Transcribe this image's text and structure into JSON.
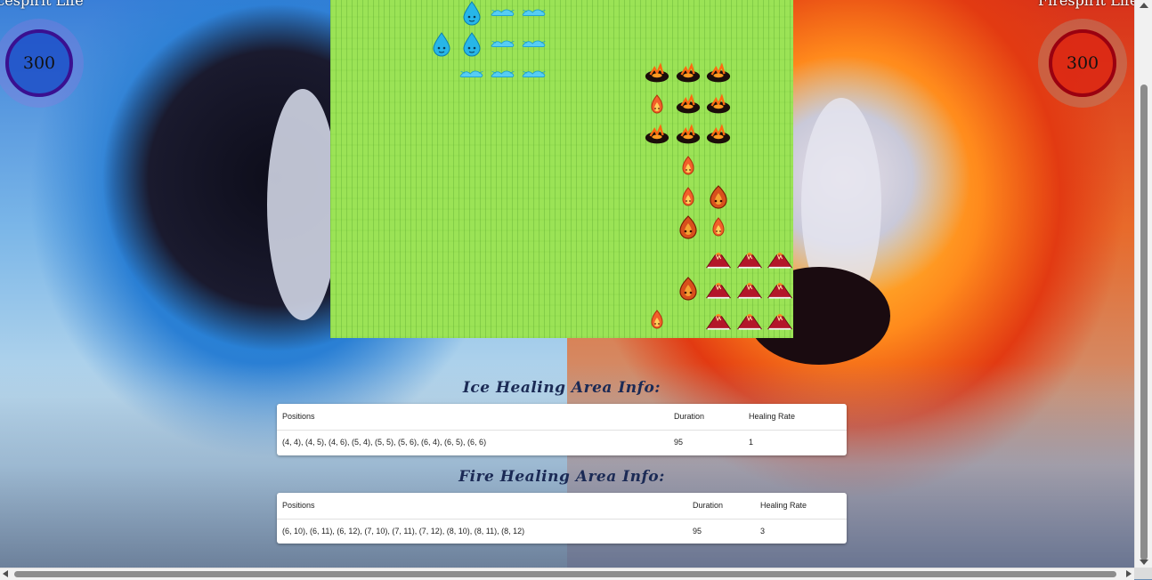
{
  "players": {
    "ice": {
      "label": "Icespirit Life",
      "life": "300",
      "color": "#3a1090"
    },
    "fire": {
      "label": "Firespirit Life",
      "life": "300",
      "color": "#9a0010"
    }
  },
  "board": {
    "background": "#9be356",
    "pieces": [
      {
        "type": "water-drop",
        "row": 0,
        "col": 4
      },
      {
        "type": "ice-cloud",
        "row": 0,
        "col": 5
      },
      {
        "type": "ice-cloud",
        "row": 0,
        "col": 6
      },
      {
        "type": "water-drop",
        "row": 1,
        "col": 3
      },
      {
        "type": "water-drop",
        "row": 1,
        "col": 4
      },
      {
        "type": "ice-cloud",
        "row": 1,
        "col": 5
      },
      {
        "type": "ice-cloud",
        "row": 1,
        "col": 6
      },
      {
        "type": "ice-cloud",
        "row": 2,
        "col": 4
      },
      {
        "type": "ice-cloud",
        "row": 2,
        "col": 5
      },
      {
        "type": "ice-cloud",
        "row": 2,
        "col": 6
      },
      {
        "type": "lava-rock",
        "row": 2,
        "col": 10
      },
      {
        "type": "lava-rock",
        "row": 2,
        "col": 11
      },
      {
        "type": "lava-rock",
        "row": 2,
        "col": 12
      },
      {
        "type": "small-flame",
        "row": 3,
        "col": 10
      },
      {
        "type": "lava-rock",
        "row": 3,
        "col": 11
      },
      {
        "type": "lava-rock",
        "row": 3,
        "col": 12
      },
      {
        "type": "lava-rock",
        "row": 4,
        "col": 10
      },
      {
        "type": "lava-rock",
        "row": 4,
        "col": 11
      },
      {
        "type": "lava-rock",
        "row": 4,
        "col": 12
      },
      {
        "type": "small-flame",
        "row": 5,
        "col": 11
      },
      {
        "type": "small-flame",
        "row": 6,
        "col": 11
      },
      {
        "type": "fire-spirit",
        "row": 6,
        "col": 12
      },
      {
        "type": "fire-spirit",
        "row": 7,
        "col": 11
      },
      {
        "type": "small-flame",
        "row": 7,
        "col": 12
      },
      {
        "type": "volcano",
        "row": 8,
        "col": 12
      },
      {
        "type": "volcano",
        "row": 8,
        "col": 13
      },
      {
        "type": "volcano",
        "row": 8,
        "col": 14
      },
      {
        "type": "fire-spirit",
        "row": 9,
        "col": 11
      },
      {
        "type": "volcano",
        "row": 9,
        "col": 12
      },
      {
        "type": "volcano",
        "row": 9,
        "col": 13
      },
      {
        "type": "volcano",
        "row": 9,
        "col": 14
      },
      {
        "type": "small-flame",
        "row": 10,
        "col": 10
      },
      {
        "type": "volcano",
        "row": 10,
        "col": 12
      },
      {
        "type": "volcano",
        "row": 10,
        "col": 13
      },
      {
        "type": "volcano",
        "row": 10,
        "col": 14
      }
    ]
  },
  "ice_info": {
    "title": "Ice Healing Area Info:",
    "headers": {
      "positions": "Positions",
      "duration": "Duration",
      "rate": "Healing Rate"
    },
    "row": {
      "positions": "(4, 4), (4, 5), (4, 6), (5, 4), (5, 5), (5, 6), (6, 4), (6, 5), (6, 6)",
      "duration": "95",
      "rate": "1"
    }
  },
  "fire_info": {
    "title": "Fire Healing Area Info:",
    "headers": {
      "positions": "Positions",
      "duration": "Duration",
      "rate": "Healing Rate"
    },
    "row": {
      "positions": "(6, 10), (6, 11), (6, 12), (7, 10), (7, 11), (7, 12), (8, 10), (8, 11), (8, 12)",
      "duration": "95",
      "rate": "3"
    }
  }
}
